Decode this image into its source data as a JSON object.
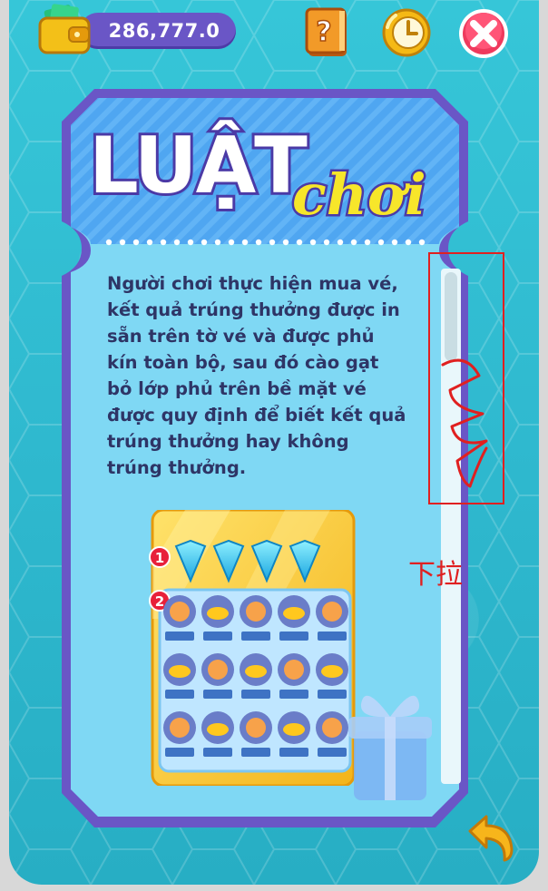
{
  "wallet": {
    "balance": "286,777.0",
    "icon": "wallet-icon"
  },
  "topbar": {
    "help_icon": "question-book-icon",
    "history_icon": "clock-icon",
    "close_icon": "close-x-icon"
  },
  "title": {
    "main": "LUẬT",
    "sub": "chơi"
  },
  "rules": {
    "text": "Người chơi thực hiện mua vé, kết quả trúng thưởng được in sẵn trên tờ vé và được phủ kín toàn bộ, sau đó cào gạt bỏ lớp phủ trên bề mặt vé được quy định để biết kết quả trúng thưởng hay không trúng thưởng."
  },
  "ticket": {
    "markers": [
      "1",
      "2"
    ],
    "stars": "★★★"
  },
  "annotation": {
    "label": "下拉"
  },
  "colors": {
    "background": "#2fb9cf",
    "panel_border": "#6a56c6",
    "panel_fill": "#7fd8f4",
    "title_yellow": "#f7e62a",
    "annotation_red": "#e02020"
  }
}
